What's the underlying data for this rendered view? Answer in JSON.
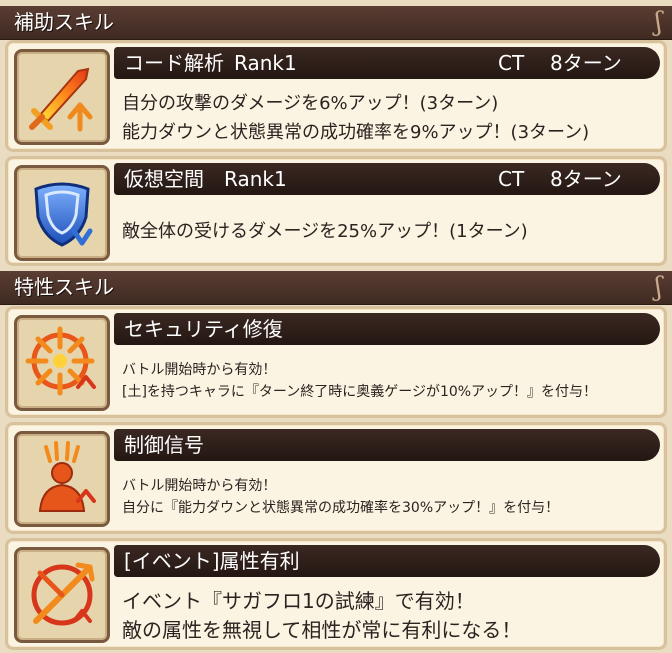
{
  "support_section": {
    "title": "補助スキル",
    "ornament": "ʃ"
  },
  "trait_section": {
    "title": "特性スキル",
    "ornament": "ʃ"
  },
  "support_skills": [
    {
      "name": "コード解析",
      "rank": "Rank1",
      "ct_label": "CT",
      "ct_value": "8ターン",
      "icon": "flaming-sword-icon",
      "lines": [
        "自分の攻撃のダメージを6%アップ！(3ターン)",
        "能力ダウンと状態異常の成功確率を9%アップ！(3ターン)"
      ]
    },
    {
      "name": "仮想空間",
      "rank": "Rank1",
      "ct_label": "CT",
      "ct_value": "8ターン",
      "icon": "shield-icon",
      "lines": [
        "敵全体の受けるダメージを25%アップ！(1ターン)"
      ]
    }
  ],
  "trait_skills": [
    {
      "name": "セキュリティ修復",
      "icon": "burst-sigil-icon",
      "lines": [
        "バトル開始時から有効！",
        "[土]を持つキャラに『ターン終了時に奥義ゲージが10%アップ！』を付与！"
      ]
    },
    {
      "name": "制御信号",
      "icon": "aura-figure-icon",
      "lines": [
        "バトル開始時から有効！",
        "自分に『能力ダウンと状態異常の成功確率を30%アップ！』を付与！"
      ]
    },
    {
      "name": "[イベント]属性有利",
      "icon": "crossed-element-icon",
      "lines": [
        "イベント『サガフロ1の試練』で有効！",
        "敵の属性を無視して相性が常に有利になる！"
      ]
    }
  ],
  "colors": {
    "header_bg": "#4a3129",
    "card_bg": "#fbf4e3",
    "name_bar_bg": "#2e1f19",
    "icon_orange": "#f28a1c",
    "icon_red": "#d8361a",
    "icon_blue": "#2f6fd6"
  }
}
